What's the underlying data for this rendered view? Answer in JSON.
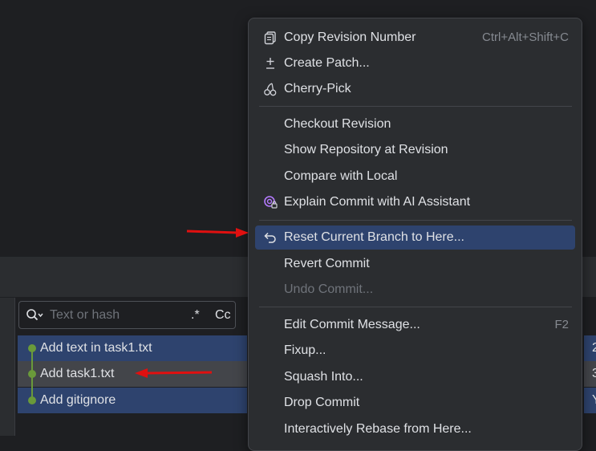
{
  "log": {
    "search": {
      "placeholder": "Text or hash",
      "regex_label": ".*",
      "case_label": "Cc"
    },
    "commits": [
      {
        "message": "Add text in task1.txt",
        "trailing": "2"
      },
      {
        "message": "Add task1.txt",
        "trailing": "3"
      },
      {
        "message": "Add gitignore",
        "trailing": "Y"
      }
    ]
  },
  "menu": {
    "items": [
      {
        "label": "Copy Revision Number",
        "shortcut": "Ctrl+Alt+Shift+C",
        "icon": "copy-icon"
      },
      {
        "label": "Create Patch...",
        "icon": "patch-icon"
      },
      {
        "label": "Cherry-Pick",
        "icon": "cherry-icon"
      },
      {
        "label": "Checkout Revision"
      },
      {
        "label": "Show Repository at Revision"
      },
      {
        "label": "Compare with Local"
      },
      {
        "label": "Explain Commit with AI Assistant",
        "icon": "ai-assistant-icon"
      },
      {
        "label": "Reset Current Branch to Here...",
        "icon": "undo-arrow-icon",
        "selected": true
      },
      {
        "label": "Revert Commit"
      },
      {
        "label": "Undo Commit...",
        "disabled": true
      },
      {
        "label": "Edit Commit Message...",
        "shortcut": "F2"
      },
      {
        "label": "Fixup..."
      },
      {
        "label": "Squash Into..."
      },
      {
        "label": "Drop Commit"
      },
      {
        "label": "Interactively Rebase from Here..."
      }
    ]
  },
  "colors": {
    "selection": "#2e436e",
    "row_hover": "#43454a",
    "graph": "#6a9a3a",
    "annotation_arrow": "#e01010"
  }
}
